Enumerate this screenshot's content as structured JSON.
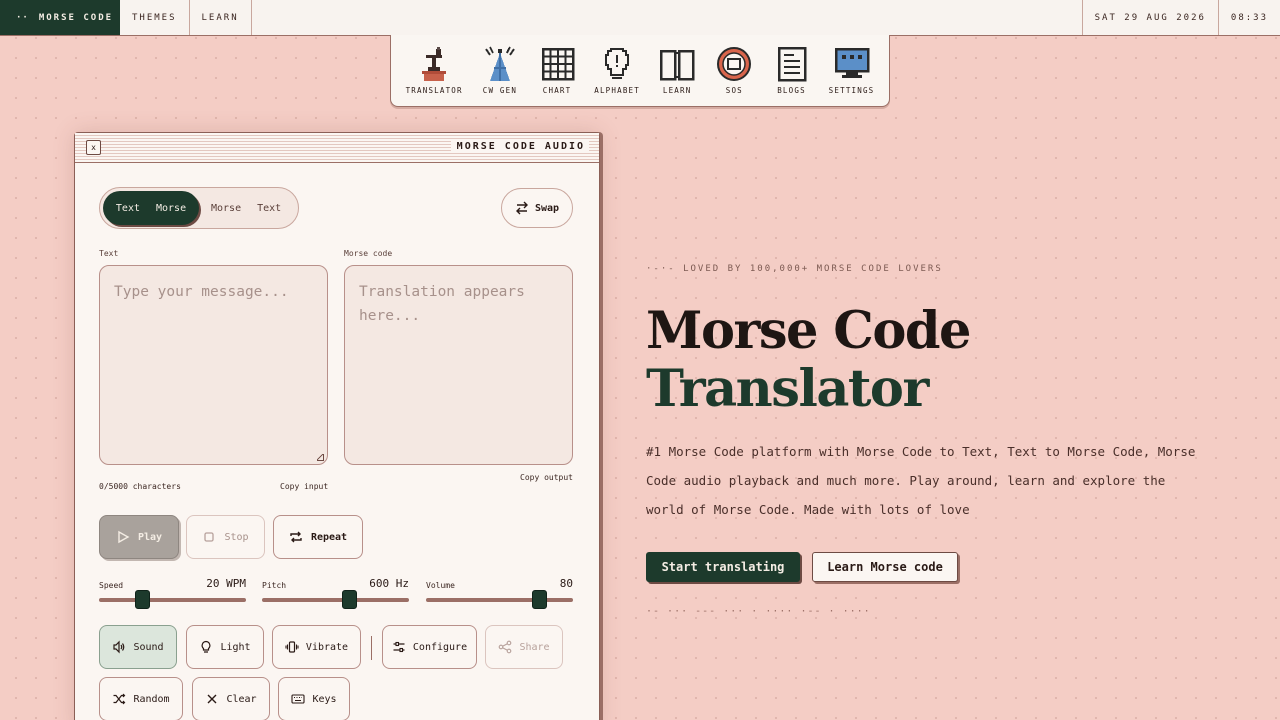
{
  "topbar": {
    "brand_dots": "··",
    "brand": "MORSE CODE",
    "links": [
      "THEMES",
      "LEARN"
    ],
    "date": "SAT 29 AUG 2026",
    "time": "08:33"
  },
  "dock": {
    "items": [
      {
        "label": "TRANSLATOR",
        "icon": "telegraph-key-icon"
      },
      {
        "label": "CW GEN",
        "icon": "radio-tower-icon"
      },
      {
        "label": "CHART",
        "icon": "grid-chart-icon"
      },
      {
        "label": "ALPHABET",
        "icon": "lightbulb-icon"
      },
      {
        "label": "LEARN",
        "icon": "open-book-icon"
      },
      {
        "label": "SOS",
        "icon": "life-ring-icon"
      },
      {
        "label": "BLOGS",
        "icon": "document-icon"
      },
      {
        "label": "SETTINGS",
        "icon": "monitor-icon"
      }
    ]
  },
  "window": {
    "close_glyph": "x",
    "title": "MORSE CODE AUDIO",
    "mode": {
      "active_from": "Text",
      "active_to": "Morse",
      "inactive_from": "Morse",
      "inactive_to": "Text"
    },
    "swap_label": "Swap",
    "input_label": "Text",
    "input_placeholder": "Type your message...",
    "output_label": "Morse code",
    "output_placeholder": "Translation appears here...",
    "char_count": "0/5000 characters",
    "copy_input": "Copy input",
    "copy_output": "Copy output",
    "controls": {
      "play": "Play",
      "stop": "Stop",
      "repeat": "Repeat"
    },
    "sliders": [
      {
        "name": "Speed",
        "value_text": "20 WPM",
        "level": 0.29
      },
      {
        "name": "Pitch",
        "value_text": "600 Hz",
        "level": 0.59
      },
      {
        "name": "Volume",
        "value_text": "80",
        "level": 0.77
      }
    ],
    "options": {
      "sound": "Sound",
      "light": "Light",
      "vibrate": "Vibrate",
      "configure": "Configure",
      "share": "Share",
      "random": "Random",
      "clear": "Clear",
      "keys": "Keys"
    }
  },
  "hero": {
    "tagline": "·-·- LOVED BY 100,000+ MORSE CODE LOVERS",
    "title_line1": "Morse Code",
    "title_line2": "Translator",
    "description": "#1 Morse Code platform with Morse Code to Text, Text to Morse Code, Morse Code audio playback and much more. Play around, learn and explore the world of Morse Code. Made with lots of love",
    "cta_primary": "Start translating",
    "cta_secondary": "Learn Morse code",
    "morse_signature": "·-  ···  ---  ···  ·  ····  ·--  ·  ····"
  },
  "colors": {
    "background": "#f4cdc5",
    "accent_green": "#1d3a2c",
    "panel": "#fbf6f2",
    "border": "#9b6f66"
  }
}
